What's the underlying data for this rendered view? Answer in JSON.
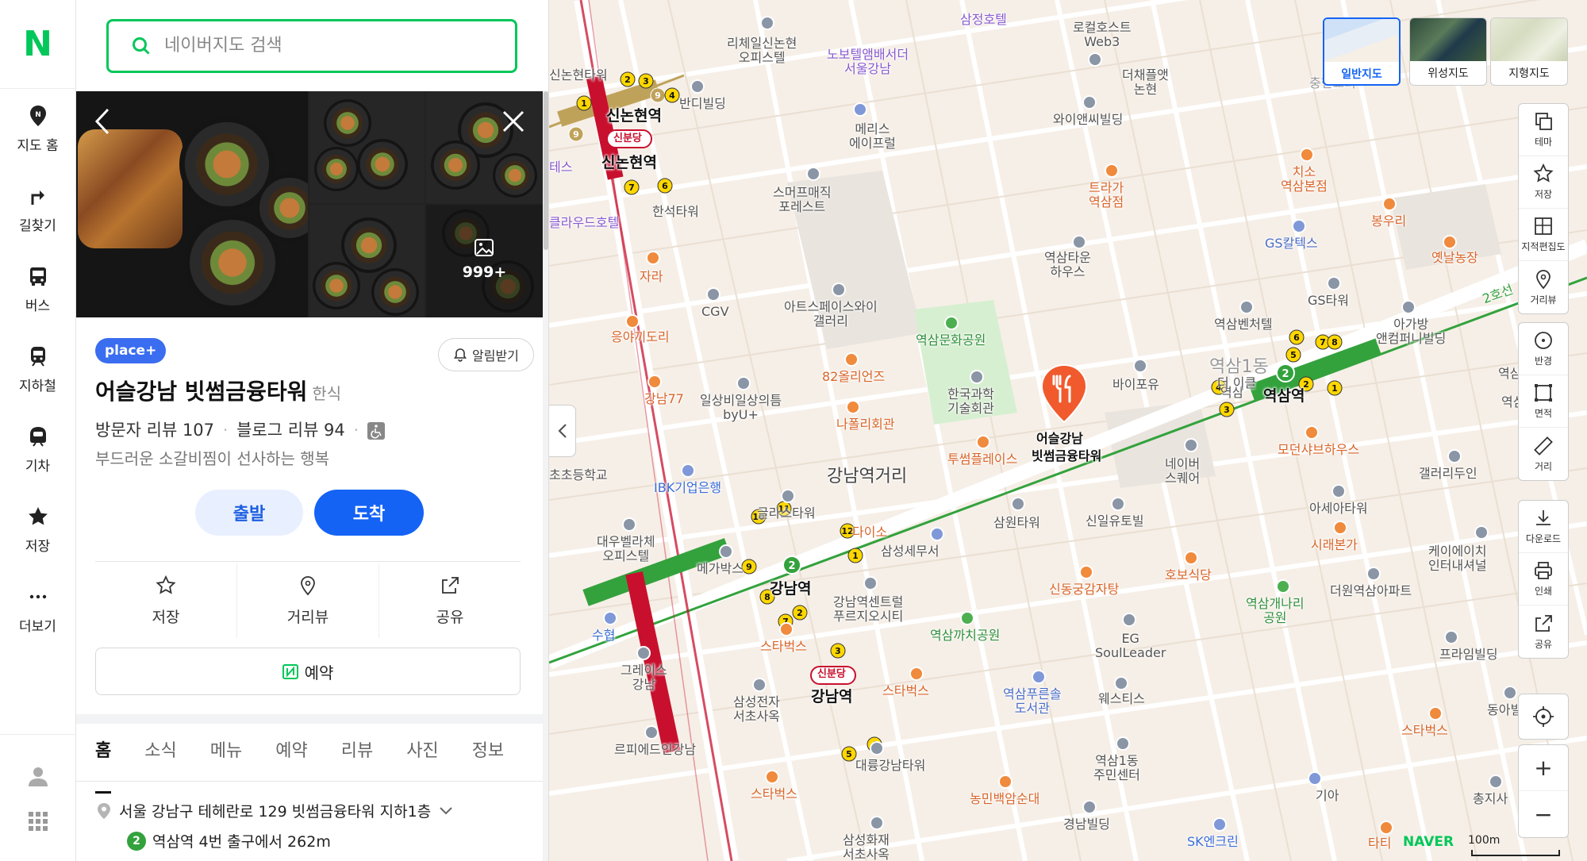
{
  "rail": {
    "logo": "N",
    "items": [
      {
        "label": "지도 홈",
        "icon": "map-home-pin-icon"
      },
      {
        "label": "길찾기",
        "icon": "directions-arrow-icon"
      },
      {
        "label": "버스",
        "icon": "bus-icon"
      },
      {
        "label": "지하철",
        "icon": "subway-icon"
      },
      {
        "label": "기차",
        "icon": "train-icon"
      },
      {
        "label": "저장",
        "icon": "star-icon"
      },
      {
        "label": "더보기",
        "icon": "more-dots-icon"
      }
    ]
  },
  "search": {
    "placeholder": "네이버지도 검색"
  },
  "gallery": {
    "photo_count": "999+"
  },
  "place": {
    "badge": "place+",
    "alert_label": "알림받기",
    "name": "어슬강남 빗썸금융타워",
    "category": "한식",
    "visitor_reviews": "방문자 리뷰 107",
    "blog_reviews": "블로그 리뷰 94",
    "description": "부드러운 소갈비찜이 선사하는 행복",
    "start_label": "출발",
    "arrive_label": "도착",
    "actions": [
      {
        "label": "저장"
      },
      {
        "label": "거리뷰"
      },
      {
        "label": "공유"
      }
    ],
    "reserve_label": "예약",
    "tabs": [
      "홈",
      "소식",
      "메뉴",
      "예약",
      "리뷰",
      "사진",
      "정보"
    ],
    "address": "서울 강남구 테헤란로 129 빗썸금융타워 지하1층",
    "subway_line": "2",
    "subway_info": "역삼역 4번 출구에서 262m"
  },
  "map": {
    "types": [
      {
        "label": "일반지도",
        "active": true
      },
      {
        "label": "위성지도",
        "active": false
      },
      {
        "label": "지형지도",
        "active": false
      }
    ],
    "tools_group1": [
      "테마",
      "저장",
      "지적편집도",
      "거리뷰"
    ],
    "tools_group2": [
      "반경",
      "면적",
      "거리"
    ],
    "tools_group3": [
      "다운로드",
      "인쇄",
      "공유"
    ],
    "zoom_in": "+",
    "zoom_out": "−",
    "naver_mark": "NAVER",
    "scale_label": "100m",
    "pin_label_1": "어슬강남",
    "pin_label_2": "빗썸금융타워",
    "line_label": "2호선",
    "labels": {
      "sinnonhyeon": "신논현역",
      "sinbundang1": "신분당",
      "sinnonhyeon2": "신논현역",
      "gangnam": "강남역",
      "sinbundang2": "신분당",
      "gangnam2": "강남역",
      "yeoksam": "역삼역",
      "yeoksam1dong": "역삼1동",
      "gangnam_street": "강남역거리",
      "l1": "삼정호텔",
      "l2": "로컬호스트\nWeb3",
      "l3": "리체일신논현\n오피스텔",
      "l4": "노보텔앰배서더\n서울강남",
      "l5": "더채플앳\n논현",
      "l6": "반디빌딩",
      "l7": "와이앤씨빌딩",
      "l8": "메리스\n에이프럴",
      "l9": "트라가\n역삼점",
      "l10": "치소\n역삼본점",
      "l11": "봉우리",
      "l12": "스머프매직\n포레스트",
      "l13": "한석타워",
      "l14": "GS칼텍스",
      "l15": "옛날농장",
      "l16": "자라",
      "l17": "역삼타운\n하우스",
      "l18": "CGV",
      "l19": "아트스페이스와이\n갤러리",
      "l20": "GS타워",
      "l21": "역삼벤처텔",
      "l22": "아가방\n앤컴퍼니빌딩",
      "l23": "응야끼도리",
      "l24": "역삼문화공원",
      "l25": "82올리언즈",
      "l26": "바이포유",
      "l27": "한국과학\n기술회관",
      "l28": "강남77",
      "l29": "일상비일상의틈\nbyU+",
      "l30": "나폴리회관",
      "l31": "모던샤브하우스",
      "l32": "갤러리두인",
      "l33": "투썸플레이스",
      "l34": "네이버\n스퀘어",
      "l35": "IBK기업은행",
      "l36": "초초등학교",
      "l37": "글라스타워",
      "l38": "다이소",
      "l39": "삼원타워",
      "l40": "신일유토빌",
      "l41": "아세아타워",
      "l42": "대우벨라체\n오피스텔",
      "l43": "삼성세무서",
      "l44": "시래본가",
      "l45": "케이에이치\n인터내셔널",
      "l46": "메가박스",
      "l47": "호보식당",
      "l48": "신동궁감자탕",
      "l49": "역삼개나리\n공원",
      "l50": "더원역삼아파트",
      "l51": "스타벅스",
      "l52": "강남역센트럴\n푸르지오시티",
      "l53": "역삼까치공원",
      "l54": "EG\nSoulLeader",
      "l55": "수협",
      "l56": "그레이스\n강남",
      "l57": "프라임빌딩",
      "l58": "스타벅스",
      "l59": "삼성전자\n서초사옥",
      "l60": "역삼푸른솔\n도서관",
      "l61": "웨스티스",
      "l62": "동아빌",
      "l63": "르피에드인강남",
      "l64": "스타벅스",
      "l65": "대륭강남타워",
      "l66": "역삼1동\n주민센터",
      "l67": "기아",
      "l68": "스타벅스",
      "l69": "농민백암순대",
      "l70": "총지사",
      "l71": "경남빌딩",
      "l72": "삼성화재\n서초사옥",
      "l73": "SK엔크린",
      "l74": "타티",
      "l75": "클라우드호텔",
      "l76": "신논현타워",
      "l77": "충현교회",
      "l78": "테스",
      "l79": "역삼",
      "l80": "더 이클",
      "l81": "역삼푸",
      "l82": "역삼",
      "l83": "이빌"
    }
  }
}
